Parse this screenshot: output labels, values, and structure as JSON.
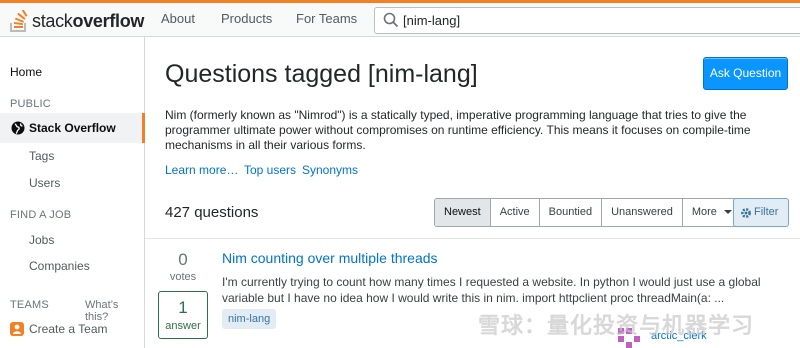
{
  "header": {
    "logo_light": "stack",
    "logo_bold": "overflow",
    "nav": [
      "About",
      "Products",
      "For Teams"
    ],
    "search_value": "[nim-lang]"
  },
  "sidebar": {
    "home": "Home",
    "public_heading": "PUBLIC",
    "active": "Stack Overflow",
    "tags": "Tags",
    "users": "Users",
    "job_heading": "FIND A JOB",
    "jobs": "Jobs",
    "companies": "Companies",
    "teams_heading": "TEAMS",
    "whats_this": "What’s this?",
    "create_team": "Create a Team"
  },
  "main": {
    "title": "Questions tagged [nim-lang]",
    "ask_label": "Ask Question",
    "description": "Nim (formerly known as \"Nimrod\") is a statically typed, imperative programming language that tries to give the programmer ultimate power without compromises on runtime efficiency. This means it focuses on compile-time mechanisms in all their various forms.",
    "links": [
      "Learn more…",
      "Top users",
      "Synonyms"
    ],
    "count": "427 questions",
    "filters": [
      "Newest",
      "Active",
      "Bountied",
      "Unanswered",
      "More"
    ],
    "selected_filter": "Newest",
    "filter_label": "Filter"
  },
  "question": {
    "votes": "0",
    "votes_label": "votes",
    "answers": "1",
    "answers_label": "answer",
    "title": "Nim counting over multiple threads",
    "excerpt": "I'm currently trying to count how many times I requested a website. In python I would just use a global variable but I have no idea how I would write this in nim. import httpclient proc threadMain(a: ...",
    "tag": "nim-lang",
    "user": "arctic_clerk"
  },
  "watermark": "雪球：量化投资与机器学习",
  "colors": {
    "brand": "#f48024",
    "accent": "#0a95ff",
    "link": "#0074cc",
    "answered": "#2f6f44"
  }
}
